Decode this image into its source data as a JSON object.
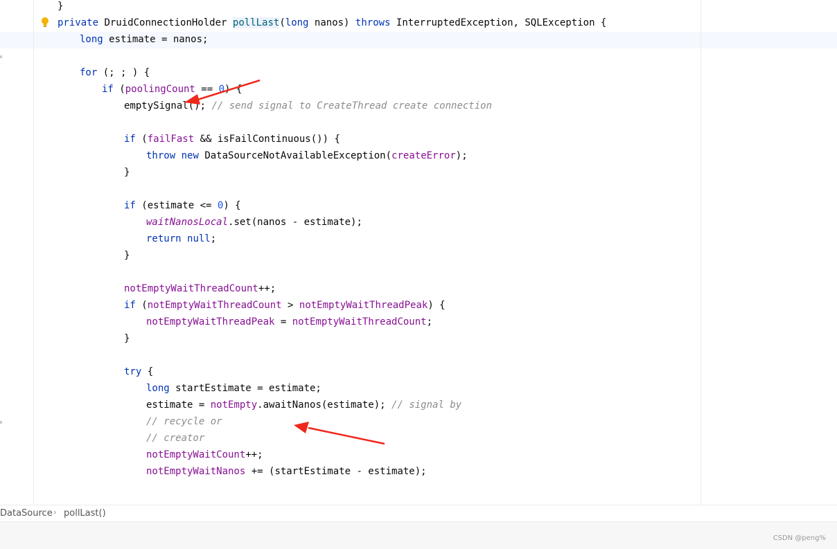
{
  "editor": {
    "lines": [
      {
        "indent": 2,
        "tokens": [
          {
            "t": "}",
            "c": ""
          }
        ]
      },
      {
        "indent": 2,
        "tokens": [
          {
            "t": "private",
            "c": "kw"
          },
          {
            "t": " DruidConnectionHolder ",
            "c": ""
          },
          {
            "t": "pollLast",
            "c": "meth hl"
          },
          {
            "t": "(",
            "c": ""
          },
          {
            "t": "long",
            "c": "kw"
          },
          {
            "t": " nanos) ",
            "c": ""
          },
          {
            "t": "throws",
            "c": "kw"
          },
          {
            "t": " InterruptedException, SQLException {",
            "c": ""
          }
        ]
      },
      {
        "indent": 3,
        "tokens": [
          {
            "t": "long",
            "c": "kw"
          },
          {
            "t": " estimate = nanos;",
            "c": ""
          }
        ]
      },
      {
        "indent": 0,
        "tokens": []
      },
      {
        "indent": 3,
        "tokens": [
          {
            "t": "for",
            "c": "kw"
          },
          {
            "t": " (; ; ) {",
            "c": ""
          }
        ]
      },
      {
        "indent": 4,
        "tokens": [
          {
            "t": "if",
            "c": "kw"
          },
          {
            "t": " (",
            "c": ""
          },
          {
            "t": "poolingCount",
            "c": "fld"
          },
          {
            "t": " == ",
            "c": ""
          },
          {
            "t": "0",
            "c": "num"
          },
          {
            "t": ") {",
            "c": ""
          }
        ]
      },
      {
        "indent": 5,
        "tokens": [
          {
            "t": "emptySignal(); ",
            "c": ""
          },
          {
            "t": "// send signal to CreateThread create connection",
            "c": "cmt"
          }
        ]
      },
      {
        "indent": 0,
        "tokens": []
      },
      {
        "indent": 5,
        "tokens": [
          {
            "t": "if",
            "c": "kw"
          },
          {
            "t": " (",
            "c": ""
          },
          {
            "t": "failFast",
            "c": "fld"
          },
          {
            "t": " && isFailContinuous()) {",
            "c": ""
          }
        ]
      },
      {
        "indent": 6,
        "tokens": [
          {
            "t": "throw",
            "c": "kw"
          },
          {
            "t": " ",
            "c": ""
          },
          {
            "t": "new",
            "c": "kw"
          },
          {
            "t": " DataSourceNotAvailableException(",
            "c": ""
          },
          {
            "t": "createError",
            "c": "fld"
          },
          {
            "t": ");",
            "c": ""
          }
        ]
      },
      {
        "indent": 5,
        "tokens": [
          {
            "t": "}",
            "c": ""
          }
        ]
      },
      {
        "indent": 0,
        "tokens": []
      },
      {
        "indent": 5,
        "tokens": [
          {
            "t": "if",
            "c": "kw"
          },
          {
            "t": " (estimate <= ",
            "c": ""
          },
          {
            "t": "0",
            "c": "num"
          },
          {
            "t": ") {",
            "c": ""
          }
        ]
      },
      {
        "indent": 6,
        "tokens": [
          {
            "t": "waitNanosLocal",
            "c": "sfld"
          },
          {
            "t": ".set(nanos - estimate);",
            "c": ""
          }
        ]
      },
      {
        "indent": 6,
        "tokens": [
          {
            "t": "return",
            "c": "kw"
          },
          {
            "t": " ",
            "c": ""
          },
          {
            "t": "null",
            "c": "kw"
          },
          {
            "t": ";",
            "c": ""
          }
        ]
      },
      {
        "indent": 5,
        "tokens": [
          {
            "t": "}",
            "c": ""
          }
        ]
      },
      {
        "indent": 0,
        "tokens": []
      },
      {
        "indent": 5,
        "tokens": [
          {
            "t": "notEmptyWaitThreadCount",
            "c": "fld"
          },
          {
            "t": "++;",
            "c": ""
          }
        ]
      },
      {
        "indent": 5,
        "tokens": [
          {
            "t": "if",
            "c": "kw"
          },
          {
            "t": " (",
            "c": ""
          },
          {
            "t": "notEmptyWaitThreadCount",
            "c": "fld"
          },
          {
            "t": " > ",
            "c": ""
          },
          {
            "t": "notEmptyWaitThreadPeak",
            "c": "fld"
          },
          {
            "t": ") {",
            "c": ""
          }
        ]
      },
      {
        "indent": 6,
        "tokens": [
          {
            "t": "notEmptyWaitThreadPeak",
            "c": "fld"
          },
          {
            "t": " = ",
            "c": ""
          },
          {
            "t": "notEmptyWaitThreadCount",
            "c": "fld"
          },
          {
            "t": ";",
            "c": ""
          }
        ]
      },
      {
        "indent": 5,
        "tokens": [
          {
            "t": "}",
            "c": ""
          }
        ]
      },
      {
        "indent": 0,
        "tokens": []
      },
      {
        "indent": 5,
        "tokens": [
          {
            "t": "try",
            "c": "kw"
          },
          {
            "t": " {",
            "c": ""
          }
        ]
      },
      {
        "indent": 6,
        "tokens": [
          {
            "t": "long",
            "c": "kw"
          },
          {
            "t": " startEstimate = estimate;",
            "c": ""
          }
        ]
      },
      {
        "indent": 6,
        "tokens": [
          {
            "t": "estimate = ",
            "c": ""
          },
          {
            "t": "notEmpty",
            "c": "fld"
          },
          {
            "t": ".awaitNanos(estimate); ",
            "c": ""
          },
          {
            "t": "// signal by",
            "c": "cmt"
          }
        ]
      },
      {
        "indent": 6,
        "tokens": [
          {
            "t": "// recycle or",
            "c": "cmt"
          }
        ]
      },
      {
        "indent": 6,
        "tokens": [
          {
            "t": "// creator",
            "c": "cmt"
          }
        ]
      },
      {
        "indent": 6,
        "tokens": [
          {
            "t": "notEmptyWaitCount",
            "c": "fld"
          },
          {
            "t": "++;",
            "c": ""
          }
        ]
      },
      {
        "indent": 6,
        "tokens": [
          {
            "t": "notEmptyWaitNanos",
            "c": "fld"
          },
          {
            "t": " += (startEstimate - estimate);",
            "c": ""
          }
        ]
      }
    ]
  },
  "breadcrumb": {
    "class_label": "DataSource",
    "separator": "›",
    "method_label": "pollLast()"
  },
  "footer": {
    "watermark": "CSDN @peng%"
  },
  "colors": {
    "keyword": "#0033b3",
    "field": "#871094",
    "number": "#1750eb",
    "comment": "#8c8c8c",
    "annotation_arrow": "#f0271b"
  },
  "icons": {
    "gutter_intention": "lightbulb-icon",
    "annotation": "red-arrow"
  }
}
